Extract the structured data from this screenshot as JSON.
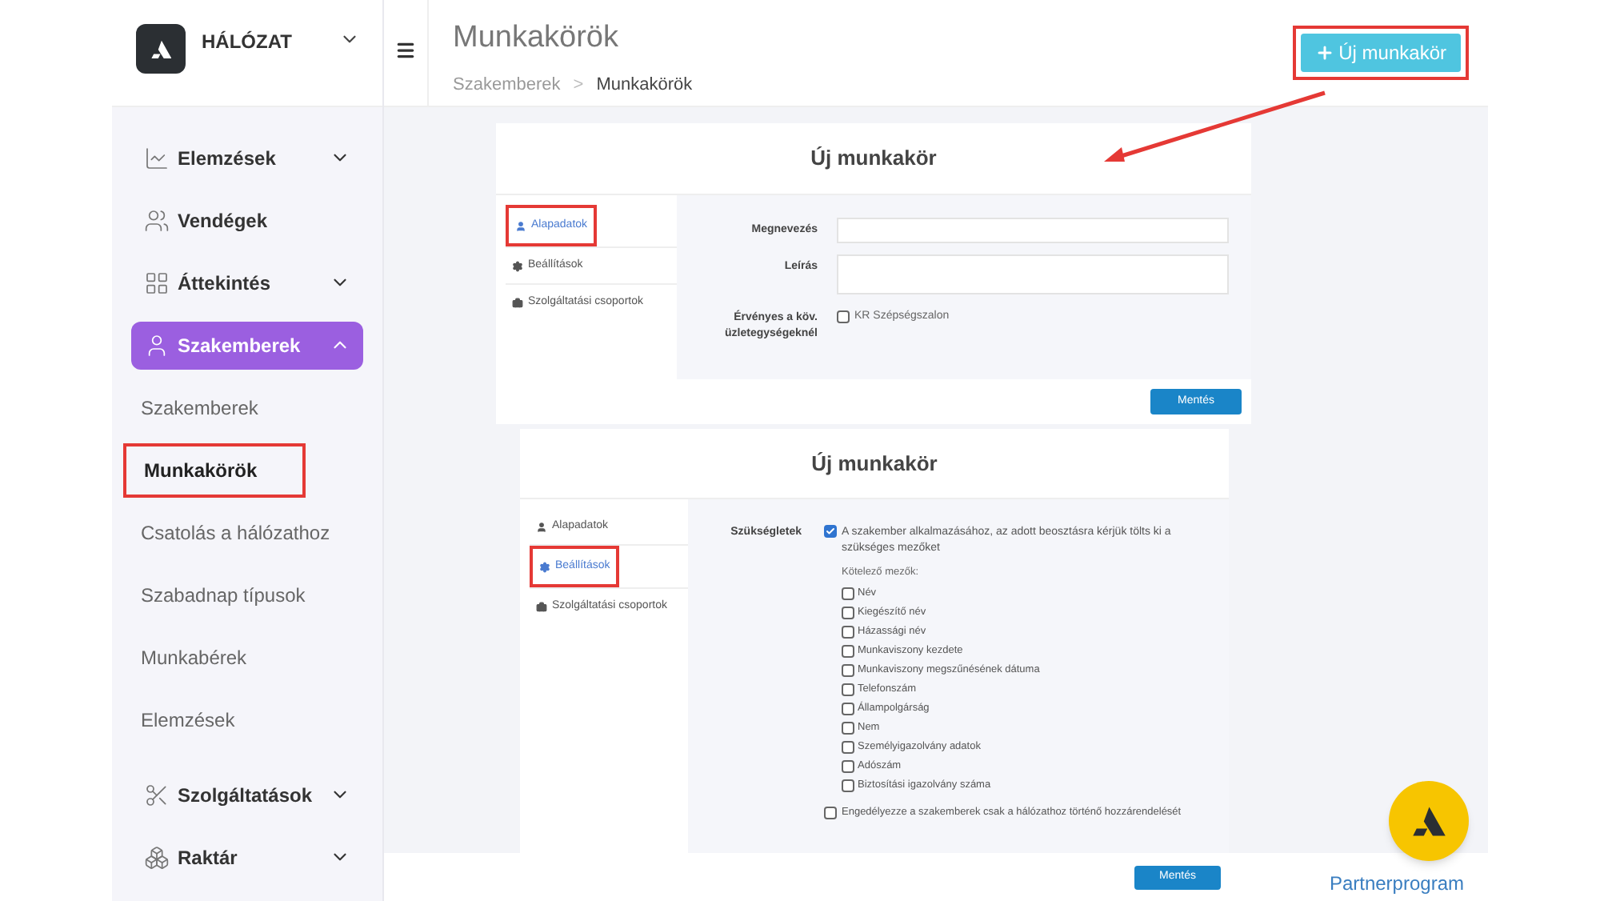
{
  "brand": {
    "name": "HÁLÓZAT"
  },
  "sidebar": {
    "items": [
      {
        "label": "Elemzések",
        "expanded": false,
        "selected": false
      },
      {
        "label": "Vendégek",
        "selected": false
      },
      {
        "label": "Áttekintés",
        "expanded": false,
        "selected": false
      },
      {
        "label": "Szakemberek",
        "expanded": true,
        "selected": true,
        "children": [
          {
            "label": "Szakemberek",
            "selected": false,
            "marked": false
          },
          {
            "label": "Munkakörök",
            "selected": true,
            "marked": true
          },
          {
            "label": "Csatolás a hálózathoz",
            "selected": false,
            "marked": false
          },
          {
            "label": "Szabadnap típusok",
            "selected": false,
            "marked": false
          },
          {
            "label": "Munkabérek",
            "selected": false,
            "marked": false
          },
          {
            "label": "Elemzések",
            "selected": false,
            "marked": false
          }
        ]
      },
      {
        "label": "Szolgáltatások",
        "expanded": false,
        "selected": false
      },
      {
        "label": "Raktár",
        "expanded": false,
        "selected": false
      }
    ]
  },
  "header": {
    "title": "Munkakörök",
    "breadcrumb": [
      "Szakemberek",
      "Munkakörök"
    ],
    "separator": ">",
    "new_button": {
      "label": "Új munkakör",
      "marked": true
    }
  },
  "screenshots": [
    {
      "title": "Új munkakör",
      "tabs": [
        {
          "label": "Alapadatok",
          "selected": true,
          "marked": true
        },
        {
          "label": "Beállítások",
          "selected": false,
          "marked": false
        },
        {
          "label": "Szolgáltatási csoportok",
          "selected": false,
          "marked": false
        }
      ],
      "fields": [
        {
          "kind": "input",
          "label": "Megnevezés"
        },
        {
          "kind": "textarea",
          "label": "Leírás"
        },
        {
          "kind": "checkbox",
          "label": "Érvényes a köv. üzletegységeknél",
          "option": "KR Szépségszalon",
          "checked": false
        }
      ],
      "save": "Mentés"
    },
    {
      "title": "Új munkakör",
      "tabs": [
        {
          "label": "Alapadatok",
          "selected": false,
          "marked": false
        },
        {
          "label": "Beállítások",
          "selected": true,
          "marked": true
        },
        {
          "label": "Szolgáltatási csoportok",
          "selected": false,
          "marked": false
        }
      ],
      "requirements": {
        "label": "Szükségletek",
        "main": {
          "label": "A szakember alkalmazásához, az adott beosztásra kérjük tölts ki a szükséges mezőket",
          "checked": true
        },
        "subheading": "Kötelező mezők:",
        "options": [
          {
            "label": "Név",
            "checked": false
          },
          {
            "label": "Kiegészítő név",
            "checked": false
          },
          {
            "label": "Házassági név",
            "checked": false
          },
          {
            "label": "Munkaviszony kezdete",
            "checked": false
          },
          {
            "label": "Munkaviszony megszűnésének dátuma",
            "checked": false
          },
          {
            "label": "Telefonszám",
            "checked": false
          },
          {
            "label": "Állampolgárság",
            "checked": false
          },
          {
            "label": "Nem",
            "checked": false
          },
          {
            "label": "Személyigazolvány adatok",
            "checked": false
          },
          {
            "label": "Adószám",
            "checked": false
          },
          {
            "label": "Biztosítási igazolvány száma",
            "checked": false
          }
        ],
        "last": {
          "label": "Engedélyezze a szakemberek csak a hálózathoz történő hozzárendelését",
          "checked": false
        }
      },
      "save": "Mentés"
    }
  ],
  "footer": {
    "link": "Partnerprogram"
  }
}
